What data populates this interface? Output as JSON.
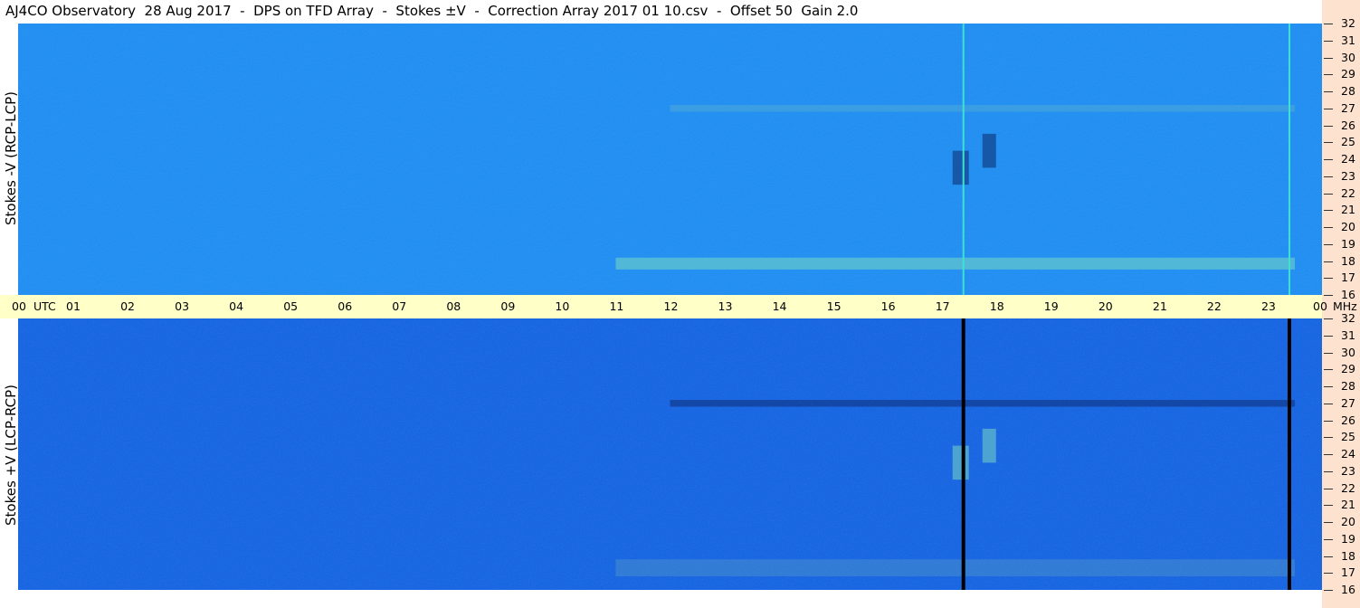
{
  "title": "AJ4CO Observatory  28 Aug 2017  -  DPS on TFD Array  -  Stokes ±V  -  Correction Array 2017 01 10.csv  -  Offset 50  Gain 2.0",
  "chart_data": [
    {
      "type": "heatmap",
      "name": "Stokes -V (RCP-LCP)",
      "ylabel": "Stokes -V  (RCP-LCP)",
      "x_range_utc": [
        0,
        24
      ],
      "y_range_mhz": [
        16,
        32
      ],
      "yticks": [
        16,
        17,
        18,
        19,
        20,
        21,
        22,
        23,
        24,
        25,
        26,
        27,
        28,
        29,
        30,
        31,
        32
      ],
      "background_color": "#1a8cf0",
      "features": [
        {
          "kind": "dark burst patch",
          "utc": [
            17.2,
            17.5
          ],
          "mhz": [
            22.5,
            24.5
          ]
        },
        {
          "kind": "dark burst patch",
          "utc": [
            17.75,
            18.0
          ],
          "mhz": [
            23.5,
            25.5
          ]
        },
        {
          "kind": "bright interference band",
          "utc": [
            11.0,
            23.5
          ],
          "mhz": [
            17.5,
            18.2
          ]
        },
        {
          "kind": "interference band",
          "utc": [
            12.0,
            23.5
          ],
          "mhz": [
            26.8,
            27.2
          ]
        },
        {
          "kind": "vertical line",
          "utc": 17.4,
          "color": "#40e0d0"
        },
        {
          "kind": "vertical line",
          "utc": 23.4,
          "color": "#40e0d0"
        }
      ]
    },
    {
      "type": "heatmap",
      "name": "Stokes +V (LCP-RCP)",
      "ylabel": "Stokes +V  (LCP-RCP)",
      "x_range_utc": [
        0,
        24
      ],
      "y_range_mhz": [
        16,
        32
      ],
      "yticks": [
        16,
        17,
        18,
        19,
        20,
        21,
        22,
        23,
        24,
        25,
        26,
        27,
        28,
        29,
        30,
        31,
        32
      ],
      "background_color": "#1060e0",
      "features": [
        {
          "kind": "bright burst patch",
          "utc": [
            17.2,
            17.5
          ],
          "mhz": [
            22.5,
            24.5
          ]
        },
        {
          "kind": "bright burst patch",
          "utc": [
            17.75,
            18.0
          ],
          "mhz": [
            23.5,
            25.5
          ]
        },
        {
          "kind": "interference band",
          "utc": [
            11.0,
            23.5
          ],
          "mhz": [
            16.8,
            17.8
          ]
        },
        {
          "kind": "dark band",
          "utc": [
            12.0,
            23.5
          ],
          "mhz": [
            26.8,
            27.2
          ]
        },
        {
          "kind": "vertical line",
          "utc": 17.4,
          "color": "#000000"
        },
        {
          "kind": "vertical line",
          "utc": 23.4,
          "color": "#000000"
        }
      ]
    }
  ],
  "time_axis": {
    "labels": [
      "00",
      "01",
      "02",
      "03",
      "04",
      "05",
      "06",
      "07",
      "08",
      "09",
      "10",
      "11",
      "12",
      "13",
      "14",
      "15",
      "16",
      "17",
      "18",
      "19",
      "20",
      "21",
      "22",
      "23",
      "00"
    ],
    "utc_label": "UTC",
    "mhz_label": "MHz"
  }
}
